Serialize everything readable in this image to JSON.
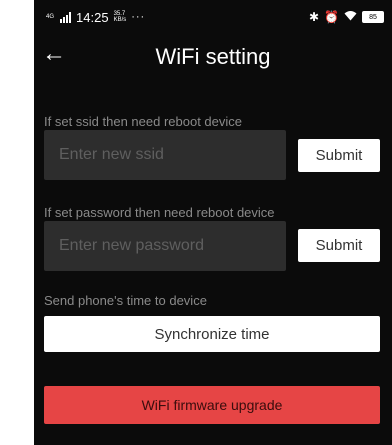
{
  "status_bar": {
    "network": "4G",
    "time": "14:25",
    "speed_value": "35.7",
    "speed_unit": "KB/s",
    "more": "···",
    "icons": [
      "bluetooth-icon",
      "alarm-icon",
      "wifi-icon"
    ],
    "battery": "85"
  },
  "header": {
    "back_icon": "arrow-left-icon",
    "title": "WiFi setting"
  },
  "ssid": {
    "label": "If set ssid then need reboot device",
    "placeholder": "Enter new ssid",
    "value": "",
    "submit_label": "Submit"
  },
  "password": {
    "label": "If set password then need reboot device",
    "placeholder": "Enter new password",
    "value": "",
    "submit_label": "Submit"
  },
  "time_sync": {
    "label": "Send phone's time to device",
    "button_label": "Synchronize time"
  },
  "upgrade": {
    "button_label": "WiFi firmware upgrade"
  },
  "colors": {
    "background": "#0b0b0b",
    "input_bg": "#2d2d2d",
    "accent_red": "#e64545",
    "label_gray": "#8a8a8a"
  }
}
